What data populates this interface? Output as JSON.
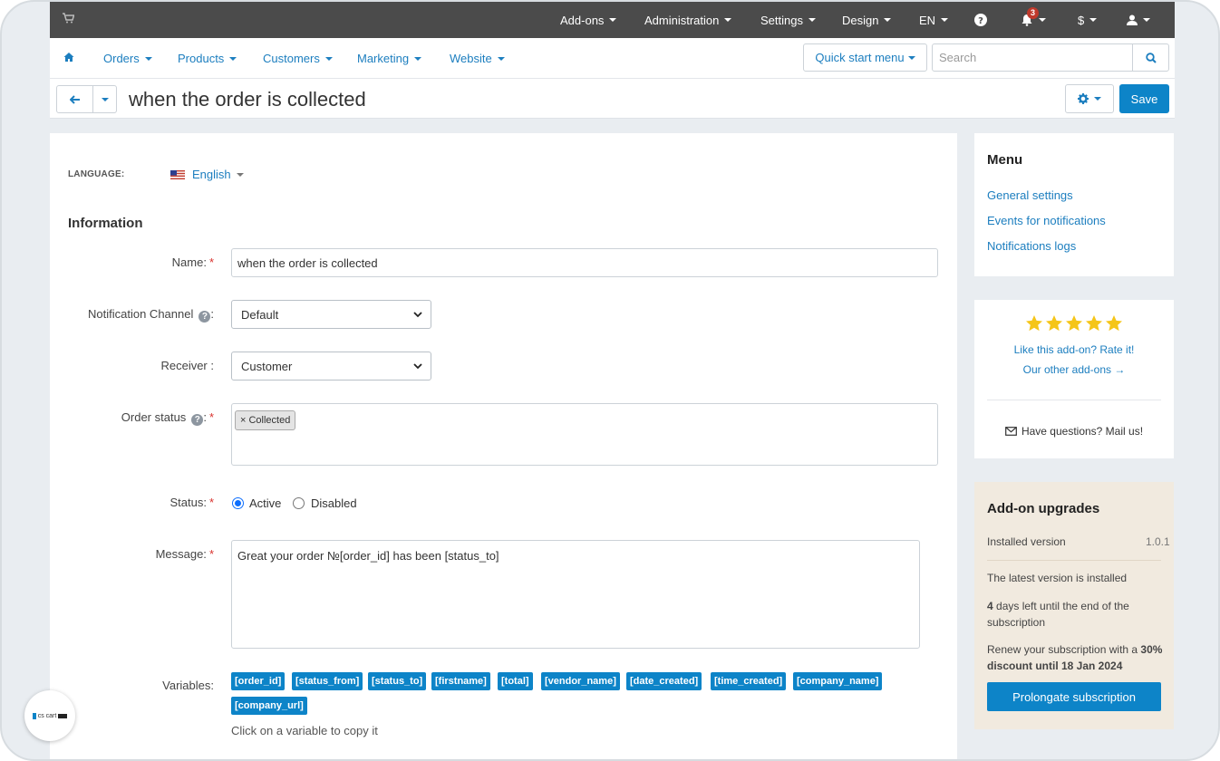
{
  "topbar": {
    "menus": [
      "Add-ons",
      "Administration",
      "Settings",
      "Design",
      "EN"
    ],
    "notifications_count": "3",
    "currency": "$"
  },
  "nav": {
    "items": [
      "Orders",
      "Products",
      "Customers",
      "Marketing",
      "Website"
    ],
    "quick_start": "Quick start menu",
    "search_placeholder": "Search"
  },
  "title": {
    "text": "when the order is collected",
    "save_label": "Save"
  },
  "form": {
    "language_label": "LANGUAGE:",
    "language_value": "English",
    "section_title": "Information",
    "name_label": "Name:",
    "name_value": "when the order is collected",
    "channel_label": "Notification Channel",
    "channel_value": "Default",
    "receiver_label": "Receiver :",
    "receiver_value": "Customer",
    "order_status_label": "Order status",
    "order_status_tag": "× Collected",
    "status_label": "Status:",
    "status_options": [
      "Active",
      "Disabled"
    ],
    "status_selected": "Active",
    "message_label": "Message:",
    "message_value": "Great your order №[order_id] has been [status_to]",
    "variables_label": "Variables:",
    "variables": [
      "[order_id]",
      "[status_from]",
      "[status_to]",
      "[firstname]",
      "[total]",
      "[vendor_name]",
      "[date_created]",
      "[time_created]",
      "[company_name]",
      "[company_url]"
    ],
    "variables_hint": "Click on a variable to copy it"
  },
  "sidebar": {
    "menu_title": "Menu",
    "menu_links": [
      "General settings",
      "Events for notifications",
      "Notifications logs"
    ],
    "rating": 5,
    "rate_link": "Like this add-on? Rate it!",
    "other_link": "Our other add-ons →",
    "mail_link": "Have questions? Mail us!",
    "upgrades_title": "Add-on upgrades",
    "installed_label": "Installed version",
    "installed_version": "1.0.1",
    "latest_text": "The latest version is installed",
    "days_left_num": "4",
    "days_left_text": " days left until the end of the subscription",
    "renew_text": "Renew your subscription with a ",
    "renew_bold": "30% discount until 18 Jan 2024",
    "prolong_label": "Prolongate subscription"
  },
  "branding": {
    "logo_text": "cs cart"
  },
  "colors": {
    "accent": "#0d84c8",
    "topbar": "#4b4b4b",
    "upgrade_bg": "#f1eadf",
    "star": "#f5c518"
  }
}
